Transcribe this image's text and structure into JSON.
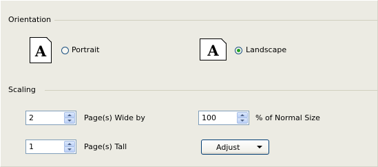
{
  "orientation": {
    "title": "Orientation",
    "portrait": {
      "icon_letter": "A",
      "label": "Portrait",
      "selected": false
    },
    "landscape": {
      "icon_letter": "A",
      "label": "Landscape",
      "selected": true
    }
  },
  "scaling": {
    "title": "Scaling",
    "pages_wide": {
      "value": "2",
      "label": "Page(s) Wide by"
    },
    "pages_tall": {
      "value": "1",
      "label": "Page(s) Tall"
    },
    "percent": {
      "value": "100",
      "label": "% of Normal Size"
    },
    "adjust_button": {
      "label": "Adjust"
    }
  }
}
